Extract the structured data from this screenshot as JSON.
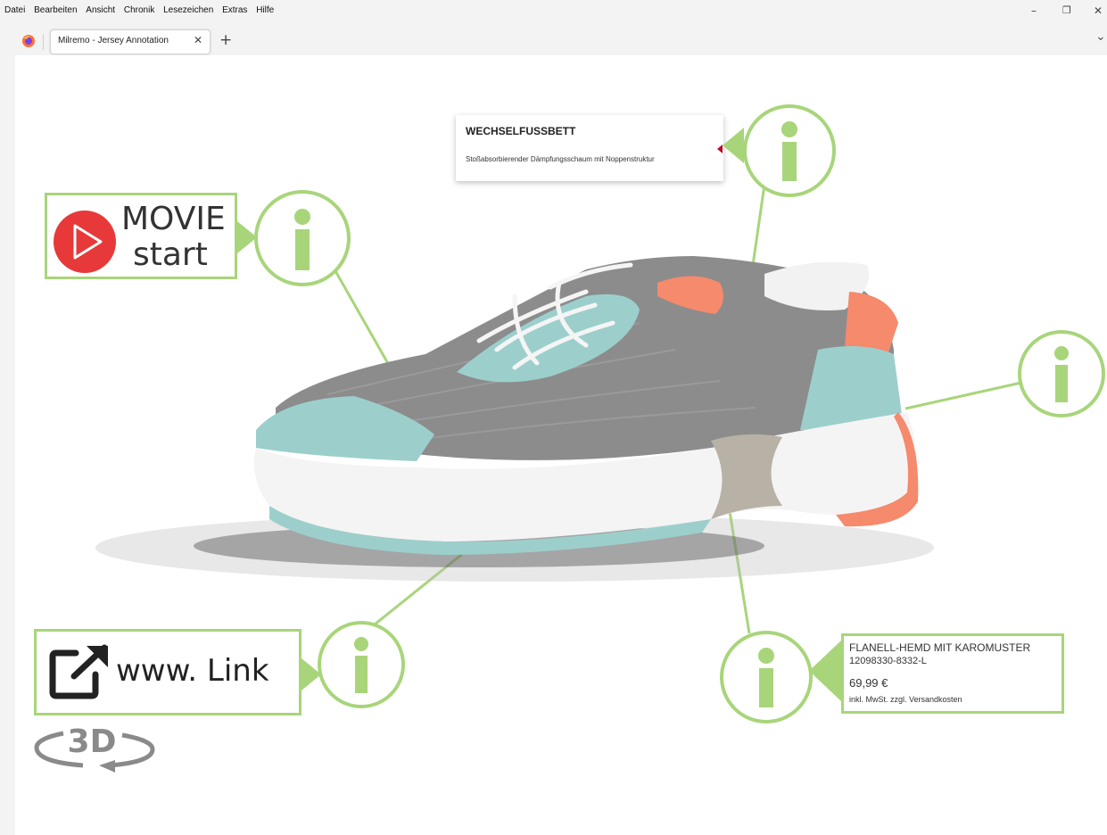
{
  "menubar": {
    "items": [
      "Datei",
      "Bearbeiten",
      "Ansicht",
      "Chronik",
      "Lesezeichen",
      "Extras",
      "Hilfe"
    ],
    "window_controls": {
      "minimize": "–",
      "restore": "❐",
      "close": "✕"
    }
  },
  "tabs": {
    "active_title": "Milremo - Jersey Annotation",
    "close_symbol": "✕",
    "new_tab_symbol": "+",
    "list_all_symbol": "⌄"
  },
  "hotspots": {
    "movie": {
      "line1": "MOVIE",
      "line2": "start"
    },
    "footbed": {
      "title": "WECHSELFUSSBETT",
      "description": "Stoßabsorbierender Dämpfungsschaum mit Noppenstruktur"
    },
    "link": {
      "label": "www. Link"
    },
    "product": {
      "name": "FLANELL-HEMD MIT KAROMUSTER",
      "sku": "12098330-8332-L",
      "price": "69,99 €",
      "tax_note": "inkl. MwSt. zzgl. Versandkosten"
    }
  },
  "badge_3d": "3D",
  "colors": {
    "accent_green": "#a8d57a",
    "play_red": "#e8393a",
    "shoe_teal": "#9ccfcc",
    "shoe_coral": "#f58a6c",
    "shoe_grey": "#8c8c8c"
  }
}
